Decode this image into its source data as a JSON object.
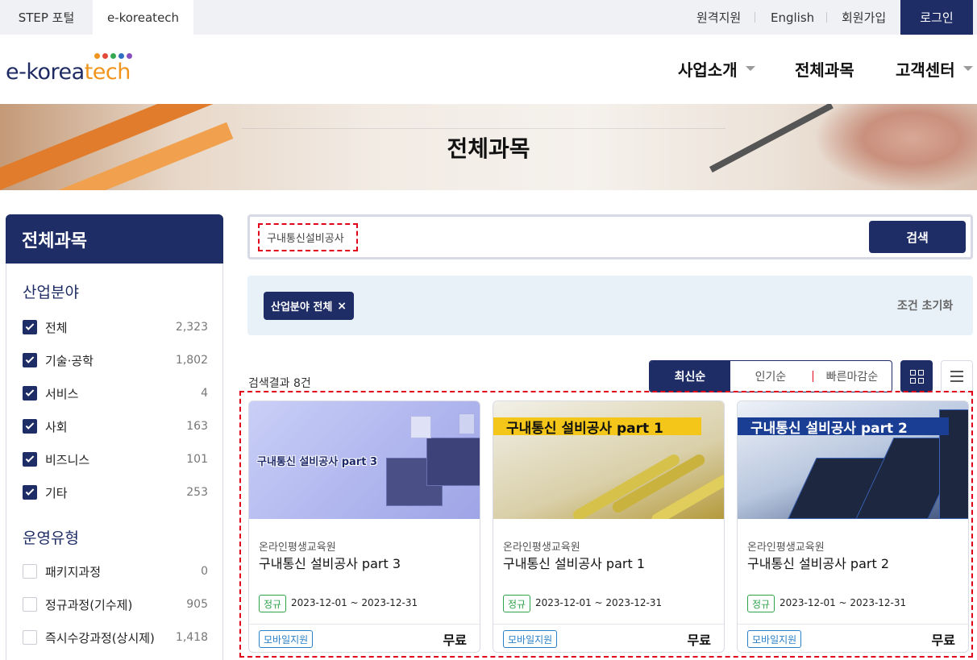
{
  "topbar": {
    "site_tabs": [
      "STEP 포털",
      "e-koreatech"
    ],
    "links": [
      "원격지원",
      "English",
      "회원가입"
    ],
    "login": "로그인"
  },
  "logo": {
    "text_a": "e-korea",
    "text_b": "tech",
    "dot_colors": [
      "#f0941d",
      "#e24a3b",
      "#36a852",
      "#2f6fc2",
      "#8a4fbf"
    ]
  },
  "gnb": [
    "사업소개",
    "전체과목",
    "고객센터"
  ],
  "banner": {
    "title": "전체과목"
  },
  "sidebar": {
    "title": "전체과목",
    "sections": [
      {
        "title": "산업분야",
        "items": [
          {
            "label": "전체",
            "count": "2,323",
            "checked": true
          },
          {
            "label": "기술·공학",
            "count": "1,802",
            "checked": true
          },
          {
            "label": "서비스",
            "count": "4",
            "checked": true
          },
          {
            "label": "사회",
            "count": "163",
            "checked": true
          },
          {
            "label": "비즈니스",
            "count": "101",
            "checked": true
          },
          {
            "label": "기타",
            "count": "253",
            "checked": true
          }
        ]
      },
      {
        "title": "운영유형",
        "items": [
          {
            "label": "패키지과정",
            "count": "0",
            "checked": false
          },
          {
            "label": "정규과정(기수제)",
            "count": "905",
            "checked": false
          },
          {
            "label": "즉시수강과정(상시제)",
            "count": "1,418",
            "checked": false
          }
        ]
      }
    ]
  },
  "search": {
    "value": "구내통신설비공사",
    "button": "검색"
  },
  "filters": {
    "chip": "산업분야 전체",
    "chip_close": "×",
    "reset": "조건 초기화"
  },
  "results": {
    "text": "검색결과 8건"
  },
  "sort": {
    "options": [
      "최신순",
      "인기순",
      "빠른마감순"
    ],
    "active": "최신순"
  },
  "view": {
    "grid": "grid-icon",
    "list": "list-icon"
  },
  "cards": [
    {
      "thumb_title": "구내통신 설비공사 part 3",
      "org": "온라인평생교육원",
      "title": "구내통신 설비공사 part 3",
      "tag": "정규",
      "date": "2023-12-01 ~ 2023-12-31",
      "mobile": "모바일지원",
      "price": "무료"
    },
    {
      "thumb_title": "구내통신 설비공사 part 1",
      "org": "온라인평생교육원",
      "title": "구내통신 설비공사 part 1",
      "tag": "정규",
      "date": "2023-12-01 ~ 2023-12-31",
      "mobile": "모바일지원",
      "price": "무료"
    },
    {
      "thumb_title": "구내통신 설비공사 part 2",
      "org": "온라인평생교육원",
      "title": "구내통신 설비공사 part 2",
      "tag": "정규",
      "date": "2023-12-01 ~ 2023-12-31",
      "mobile": "모바일지원",
      "price": "무료"
    }
  ]
}
